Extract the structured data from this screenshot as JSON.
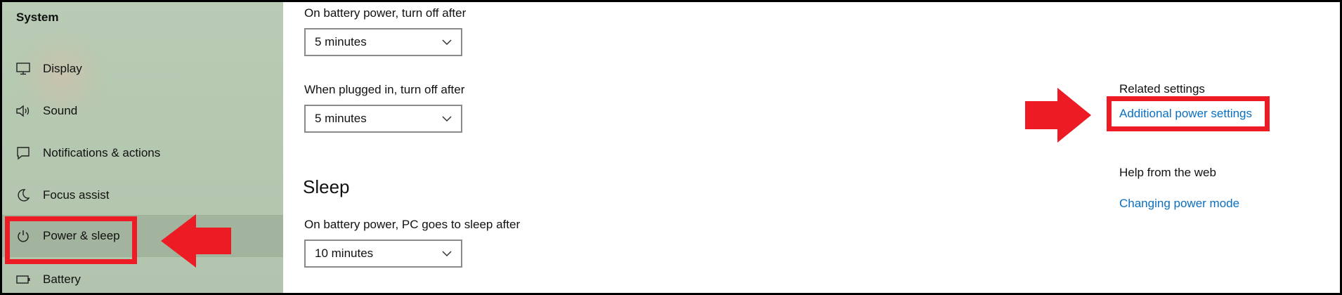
{
  "sidebar": {
    "title": "System",
    "items": [
      {
        "label": "Display",
        "icon": "monitor-icon"
      },
      {
        "label": "Sound",
        "icon": "speaker-icon"
      },
      {
        "label": "Notifications & actions",
        "icon": "notification-icon"
      },
      {
        "label": "Focus assist",
        "icon": "moon-icon"
      },
      {
        "label": "Power & sleep",
        "icon": "power-icon",
        "selected": true
      },
      {
        "label": "Battery",
        "icon": "battery-icon"
      }
    ]
  },
  "screen": {
    "battery_label": "On battery power, turn off after",
    "battery_value": "5 minutes",
    "plugged_label": "When plugged in, turn off after",
    "plugged_value": "5 minutes"
  },
  "sleep": {
    "title": "Sleep",
    "battery_label": "On battery power, PC goes to sleep after",
    "battery_value": "10 minutes"
  },
  "related": {
    "title": "Related settings",
    "link": "Additional power settings"
  },
  "help": {
    "title": "Help from the web",
    "link": "Changing power mode"
  },
  "annotation_color": "#ec1b24",
  "link_color": "#0a6fc2"
}
